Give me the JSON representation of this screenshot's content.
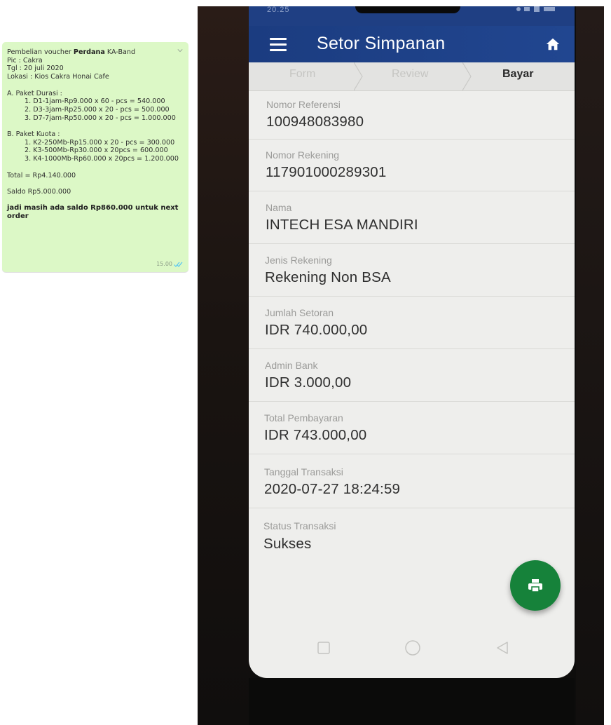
{
  "chat": {
    "line1_prefix": "Pembelian voucher ",
    "line1_bold": "Perdana",
    "line1_suffix": " KA-Band",
    "pic": "Pic : Cakra",
    "tgl": "Tgl : 20 juli 2020",
    "lokasi": "Lokasi : Kios Cakra Honai Cafe",
    "section_a": "A. Paket Durasi :",
    "durasi_items": [
      "1. D1-1jam-Rp9.000 x 60 - pcs = 540.000",
      "2. D3-3jam-Rp25.000 x 20 - pcs = 500.000",
      "3. D7-7jam-Rp50.000 x 20 - pcs = 1.000.000"
    ],
    "section_b": "B. Paket Kuota :",
    "kuota_items": [
      "1. K2-250Mb-Rp15.000 x 20 - pcs = 300.000",
      "2. K3-500Mb-Rp30.000 x 20pcs = 600.000",
      "3. K4-1000Mb-Rp60.000 x 20pcs = 1.200.000"
    ],
    "total": "Total = Rp4.140.000",
    "saldo": "Saldo Rp5.000.000",
    "conclusion": "jadi masih ada saldo Rp860.000 untuk next order",
    "time": "15.00"
  },
  "phone": {
    "status_time": "20.25",
    "title": "Setor Simpanan",
    "steps": [
      "Form",
      "Review",
      "Bayar"
    ],
    "active_step": "Bayar",
    "fields": [
      {
        "label": "Nomor Referensi",
        "value": "100948083980"
      },
      {
        "label": "Nomor Rekening",
        "value": "117901000289301"
      },
      {
        "label": "Nama",
        "value": "INTECH ESA MANDIRI"
      },
      {
        "label": "Jenis Rekening",
        "value": "Rekening Non BSA"
      },
      {
        "label": "Jumlah Setoran",
        "value": "IDR 740.000,00"
      },
      {
        "label": "Admin Bank",
        "value": "IDR 3.000,00"
      },
      {
        "label": "Total Pembayaran",
        "value": "IDR 743.000,00"
      },
      {
        "label": "Tanggal Transaksi",
        "value": "2020-07-27 18:24:59"
      },
      {
        "label": "Status Transaksi",
        "value": "Sukses"
      }
    ],
    "icons": {
      "menu": "hamburger-menu-icon",
      "home": "home-icon",
      "print": "print-icon",
      "nav": [
        "square-recents-icon",
        "circle-home-icon",
        "triangle-back-icon"
      ]
    },
    "colors": {
      "appbar": "#1f3f83",
      "fab": "#16823a",
      "chat_bubble": "#dcf8c6",
      "read_ticks": "#4fc3f7"
    }
  }
}
